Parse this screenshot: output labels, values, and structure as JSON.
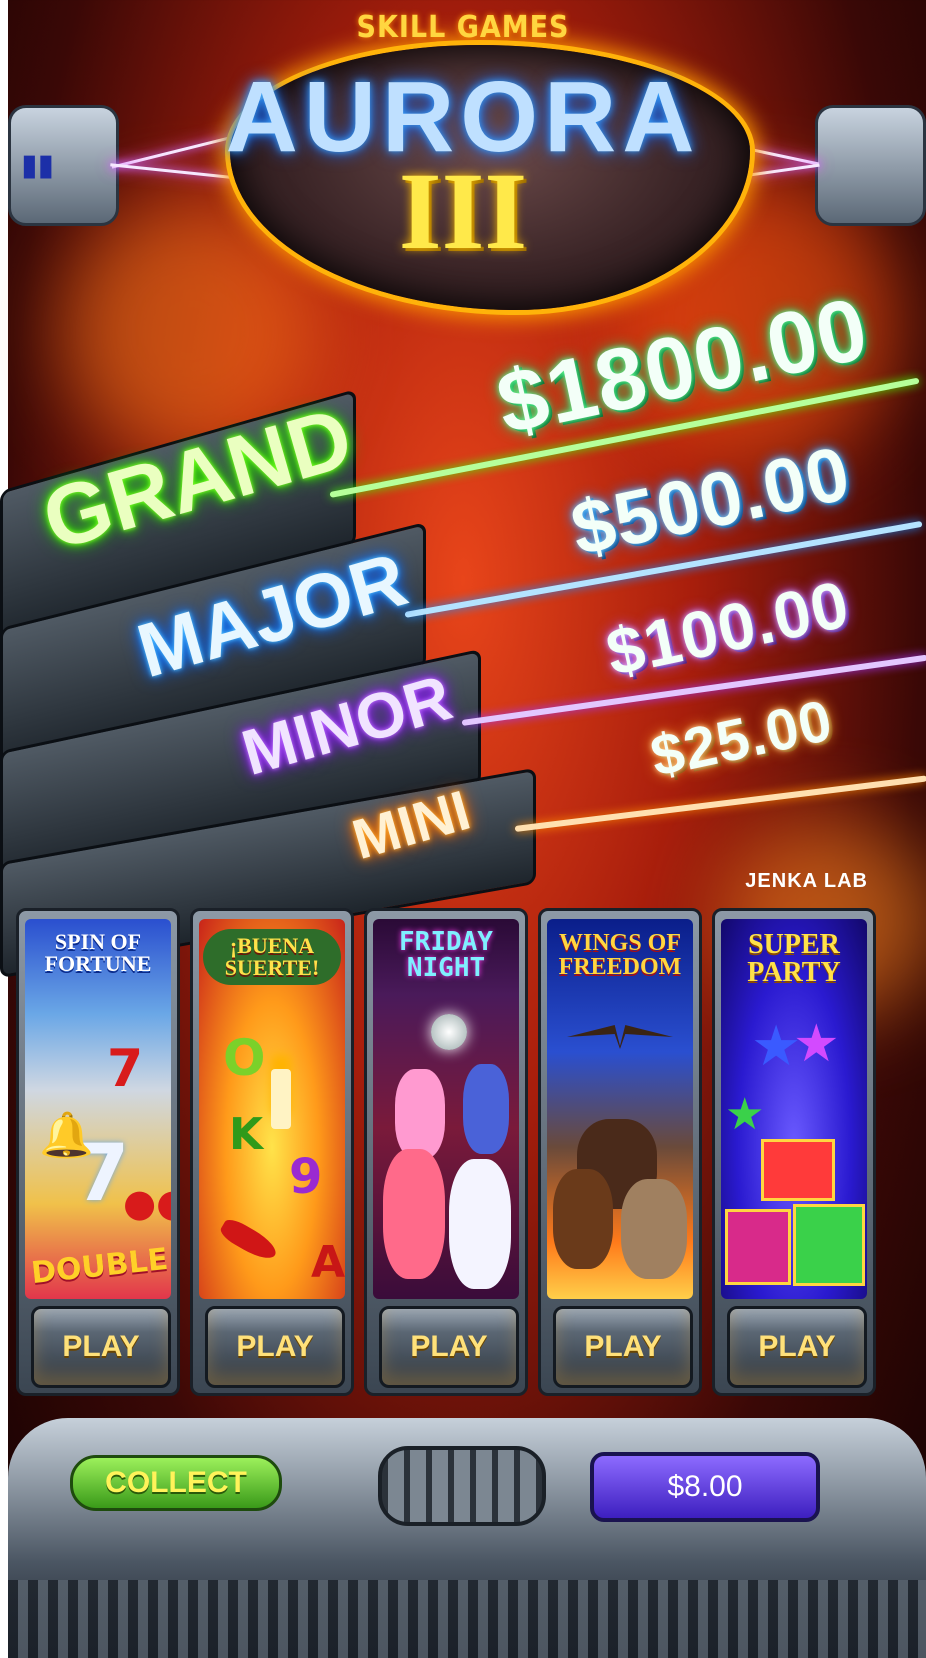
{
  "header": {
    "subtitle": "SKILL GAMES",
    "logo_name": "AURORA",
    "logo_numeral": "III"
  },
  "jackpots": [
    {
      "label": "GRAND",
      "amount": "$1800.00",
      "color": "#42ff00"
    },
    {
      "label": "MAJOR",
      "amount": "$500.00",
      "color": "#1c8cff"
    },
    {
      "label": "MINOR",
      "amount": "$100.00",
      "color": "#a535ff"
    },
    {
      "label": "MINI",
      "amount": "$25.00",
      "color": "#ff8a00"
    }
  ],
  "brand": "JENKA LAB",
  "games": [
    {
      "title": "SPIN OF FORTUNE",
      "art_text": "DOUBLE",
      "play_label": "PLAY"
    },
    {
      "title": "¡BUENA SUERTE!",
      "play_label": "PLAY"
    },
    {
      "title": "FRIDAY NIGHT",
      "play_label": "PLAY"
    },
    {
      "title": "WINGS OF FREEDOM",
      "play_label": "PLAY"
    },
    {
      "title": "SUPER PARTY",
      "play_label": "PLAY"
    }
  ],
  "footer": {
    "collect_label": "COLLECT",
    "credit": "$8.00"
  }
}
